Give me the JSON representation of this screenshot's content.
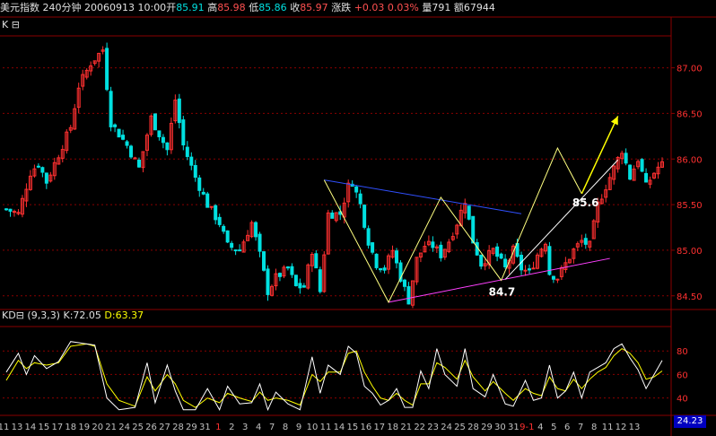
{
  "header": {
    "title": "美元指数",
    "period": "240分钟",
    "datetime": "20060913 10:00",
    "open_label": "开",
    "open": "85.91",
    "high_label": "高",
    "high": "85.98",
    "low_label": "低",
    "low": "85.86",
    "close_label": "收",
    "close": "85.97",
    "change_label": "涨跌",
    "change": "+0.03",
    "change_pct": "0.03%",
    "volume_label": "量",
    "volume": "791",
    "amount_label": "额",
    "amount": "67944"
  },
  "main_panel": {
    "label": "K",
    "toggle": "⊟"
  },
  "kd_panel": {
    "label": "KD",
    "toggle": "⊟",
    "params": "(9,3,3)",
    "k_label": "K:",
    "k": "72.05",
    "d_label": "D:",
    "d": "63.37",
    "corner_value": "24.23"
  },
  "annotations": {
    "high_point": "85.6",
    "low_point": "84.7"
  },
  "colors": {
    "up": "#ff3030",
    "down": "#00e0e0",
    "k_line": "#ffffff",
    "d_line": "#ffff00",
    "grid": "#8a0000",
    "trend_blue": "#3050ff",
    "trend_pink": "#ff40ff",
    "zigzag": "#ffff80",
    "arrow": "#ffff00"
  },
  "chart_data": [
    {
      "type": "candlestick",
      "ylim": [
        84.35,
        87.35
      ],
      "yticks": [
        84.5,
        85.0,
        85.5,
        86.0,
        86.5,
        87.0
      ],
      "ytick_labels": [
        "84.50",
        "85.00",
        "85.50",
        "86.00",
        "86.50",
        "87.00"
      ],
      "anchors": [
        [
          0,
          85.45
        ],
        [
          3,
          85.4
        ],
        [
          6,
          85.85
        ],
        [
          8,
          85.95
        ],
        [
          10,
          85.75
        ],
        [
          14,
          86.15
        ],
        [
          16,
          86.35
        ],
        [
          18,
          86.8
        ],
        [
          21,
          87.05
        ],
        [
          24,
          87.2
        ],
        [
          26,
          86.4
        ],
        [
          30,
          86.15
        ],
        [
          33,
          85.9
        ],
        [
          36,
          86.45
        ],
        [
          40,
          86.1
        ],
        [
          42,
          86.65
        ],
        [
          44,
          86.15
        ],
        [
          47,
          85.8
        ],
        [
          50,
          85.5
        ],
        [
          53,
          85.3
        ],
        [
          55,
          85.05
        ],
        [
          58,
          85.0
        ],
        [
          61,
          85.3
        ],
        [
          63,
          84.95
        ],
        [
          65,
          84.55
        ],
        [
          67,
          84.7
        ],
        [
          70,
          84.8
        ],
        [
          72,
          84.6
        ],
        [
          74,
          84.6
        ],
        [
          76,
          85.0
        ],
        [
          78,
          84.55
        ],
        [
          80,
          85.4
        ],
        [
          83,
          85.4
        ],
        [
          85,
          85.7
        ],
        [
          86,
          85.75
        ],
        [
          88,
          85.5
        ],
        [
          90,
          85.1
        ],
        [
          92,
          84.85
        ],
        [
          94,
          84.8
        ],
        [
          96,
          85.0
        ],
        [
          98,
          84.7
        ],
        [
          100,
          84.45
        ],
        [
          102,
          84.9
        ],
        [
          104,
          85.05
        ],
        [
          106,
          85.05
        ],
        [
          108,
          84.95
        ],
        [
          110,
          85.1
        ],
        [
          112,
          85.3
        ],
        [
          114,
          85.55
        ],
        [
          116,
          85.1
        ],
        [
          118,
          84.85
        ],
        [
          121,
          85.0
        ],
        [
          124,
          84.8
        ],
        [
          126,
          85.0
        ],
        [
          128,
          84.8
        ],
        [
          130,
          84.75
        ],
        [
          132,
          84.95
        ],
        [
          134,
          85.1
        ],
        [
          135,
          84.75
        ],
        [
          137,
          84.7
        ],
        [
          139,
          84.85
        ],
        [
          141,
          85.0
        ],
        [
          143,
          85.1
        ],
        [
          145,
          85.05
        ],
        [
          147,
          85.5
        ],
        [
          149,
          85.7
        ],
        [
          151,
          85.9
        ],
        [
          153,
          86.1
        ],
        [
          155,
          85.8
        ],
        [
          157,
          86.0
        ],
        [
          159,
          85.7
        ],
        [
          161,
          85.85
        ],
        [
          163,
          85.97
        ]
      ],
      "count": 164
    },
    {
      "type": "line",
      "name": "KD (9,3,3)",
      "ylim": [
        26,
        100
      ],
      "yticks": [
        40,
        60,
        80
      ],
      "ytick_labels": [
        "40",
        "60",
        "80"
      ],
      "x_ticks": [
        "11",
        "13",
        "14",
        "15",
        "17",
        "18",
        "19",
        "20",
        "21",
        "24",
        "25",
        "26",
        "27",
        "28",
        "29",
        "31",
        "1",
        "2",
        "3",
        "4",
        "7",
        "8",
        "9",
        "10",
        "11",
        "14",
        "15",
        "16",
        "17",
        "18",
        "21",
        "22",
        "23",
        "24",
        "25",
        "28",
        "29",
        "30",
        "31",
        "9-1",
        "4",
        "5",
        "6",
        "7",
        "8",
        "11",
        "12",
        "13"
      ],
      "k_anchors": [
        [
          0,
          62
        ],
        [
          3,
          78
        ],
        [
          5,
          60
        ],
        [
          7,
          76
        ],
        [
          10,
          65
        ],
        [
          13,
          71
        ],
        [
          16,
          88
        ],
        [
          20,
          86
        ],
        [
          22,
          85
        ],
        [
          25,
          40
        ],
        [
          28,
          30
        ],
        [
          32,
          32
        ],
        [
          35,
          70
        ],
        [
          37,
          36
        ],
        [
          40,
          68
        ],
        [
          42,
          46
        ],
        [
          44,
          30
        ],
        [
          47,
          30
        ],
        [
          50,
          48
        ],
        [
          53,
          30
        ],
        [
          55,
          50
        ],
        [
          58,
          35
        ],
        [
          61,
          36
        ],
        [
          63,
          52
        ],
        [
          65,
          30
        ],
        [
          67,
          45
        ],
        [
          70,
          35
        ],
        [
          73,
          30
        ],
        [
          76,
          75
        ],
        [
          78,
          44
        ],
        [
          80,
          68
        ],
        [
          83,
          60
        ],
        [
          85,
          84
        ],
        [
          87,
          78
        ],
        [
          89,
          50
        ],
        [
          91,
          44
        ],
        [
          93,
          34
        ],
        [
          95,
          38
        ],
        [
          97,
          48
        ],
        [
          99,
          32
        ],
        [
          101,
          32
        ],
        [
          103,
          63
        ],
        [
          105,
          48
        ],
        [
          107,
          82
        ],
        [
          109,
          60
        ],
        [
          112,
          50
        ],
        [
          114,
          82
        ],
        [
          116,
          48
        ],
        [
          119,
          41
        ],
        [
          121,
          60
        ],
        [
          124,
          35
        ],
        [
          126,
          33
        ],
        [
          129,
          55
        ],
        [
          131,
          38
        ],
        [
          133,
          40
        ],
        [
          135,
          68
        ],
        [
          137,
          40
        ],
        [
          139,
          46
        ],
        [
          141,
          62
        ],
        [
          143,
          40
        ],
        [
          145,
          62
        ],
        [
          147,
          66
        ],
        [
          149,
          70
        ],
        [
          151,
          82
        ],
        [
          153,
          86
        ],
        [
          155,
          74
        ],
        [
          157,
          64
        ],
        [
          159,
          48
        ],
        [
          161,
          60
        ],
        [
          163,
          72
        ]
      ],
      "d_anchors": [
        [
          0,
          55
        ],
        [
          3,
          72
        ],
        [
          5,
          65
        ],
        [
          7,
          70
        ],
        [
          10,
          68
        ],
        [
          13,
          70
        ],
        [
          16,
          84
        ],
        [
          20,
          86
        ],
        [
          22,
          84
        ],
        [
          25,
          52
        ],
        [
          28,
          38
        ],
        [
          32,
          33
        ],
        [
          35,
          58
        ],
        [
          37,
          46
        ],
        [
          40,
          60
        ],
        [
          42,
          52
        ],
        [
          44,
          38
        ],
        [
          47,
          32
        ],
        [
          50,
          40
        ],
        [
          53,
          36
        ],
        [
          55,
          44
        ],
        [
          58,
          40
        ],
        [
          61,
          37
        ],
        [
          63,
          45
        ],
        [
          65,
          38
        ],
        [
          67,
          40
        ],
        [
          70,
          38
        ],
        [
          73,
          34
        ],
        [
          76,
          60
        ],
        [
          78,
          54
        ],
        [
          80,
          62
        ],
        [
          83,
          62
        ],
        [
          85,
          78
        ],
        [
          87,
          80
        ],
        [
          89,
          62
        ],
        [
          91,
          50
        ],
        [
          93,
          40
        ],
        [
          95,
          38
        ],
        [
          97,
          44
        ],
        [
          99,
          38
        ],
        [
          101,
          34
        ],
        [
          103,
          52
        ],
        [
          105,
          52
        ],
        [
          107,
          70
        ],
        [
          109,
          66
        ],
        [
          112,
          56
        ],
        [
          114,
          72
        ],
        [
          116,
          58
        ],
        [
          119,
          46
        ],
        [
          121,
          54
        ],
        [
          124,
          44
        ],
        [
          126,
          38
        ],
        [
          129,
          48
        ],
        [
          131,
          44
        ],
        [
          133,
          42
        ],
        [
          135,
          58
        ],
        [
          137,
          48
        ],
        [
          139,
          46
        ],
        [
          141,
          56
        ],
        [
          143,
          48
        ],
        [
          145,
          56
        ],
        [
          147,
          62
        ],
        [
          149,
          66
        ],
        [
          151,
          76
        ],
        [
          153,
          82
        ],
        [
          155,
          78
        ],
        [
          157,
          70
        ],
        [
          159,
          56
        ],
        [
          161,
          58
        ],
        [
          163,
          63
        ]
      ]
    }
  ],
  "overlays": {
    "blue_line": [
      [
        79,
        85.77
      ],
      [
        128,
        85.4
      ]
    ],
    "pink_line": [
      [
        95,
        84.43
      ],
      [
        150,
        84.91
      ]
    ],
    "white_line": [
      [
        124,
        84.68
      ],
      [
        152,
        85.99
      ]
    ],
    "zigzag": [
      [
        79,
        85.77
      ],
      [
        95,
        84.43
      ],
      [
        108,
        85.58
      ],
      [
        123,
        84.67
      ],
      [
        137,
        86.12
      ],
      [
        143,
        85.62
      ]
    ],
    "arrow": [
      [
        143,
        85.62
      ],
      [
        152,
        86.47
      ]
    ]
  }
}
